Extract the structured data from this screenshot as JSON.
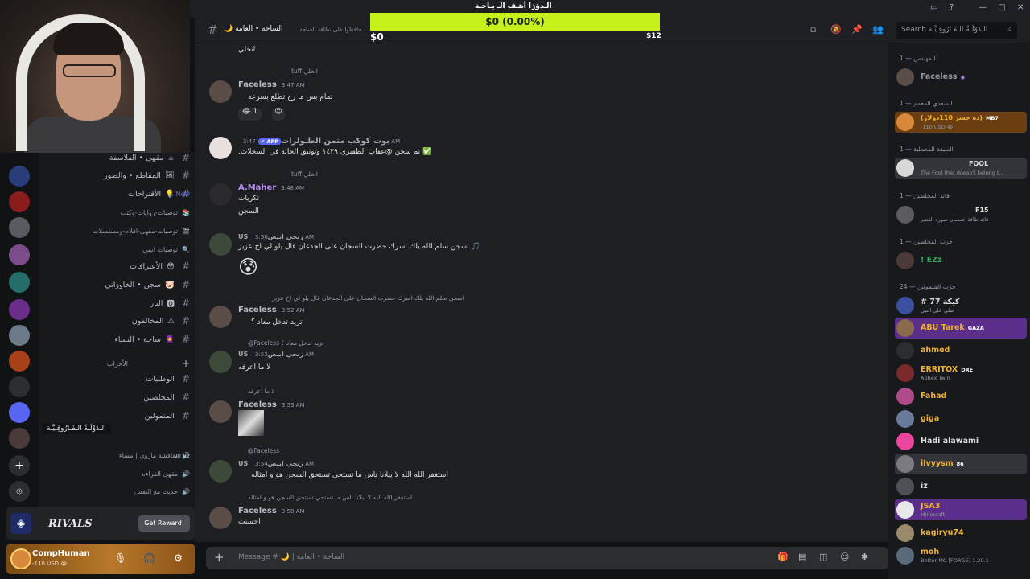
{
  "donation": {
    "title": "الـدۆۯا أهـف الـ يـاحـة",
    "amount_text": "$0 (0.00%)",
    "min": "$0",
    "max": "$12",
    "progress_percent": 0
  },
  "header": {
    "channel": "الساحة • العامة",
    "moon": "🌙",
    "topic": "حافظوا على نظافة الساحة",
    "search_placeholder": "Search الـدَوْلَـةُ الـفَـارُوقِـيَّـة"
  },
  "sidebar": {
    "channels": [
      {
        "label": "مقهى • الفلاسفة",
        "emoji": "☕"
      },
      {
        "label": "المقاطع • والصور",
        "emoji": "🖼"
      },
      {
        "label": "الأقتراحات",
        "emoji": "💡",
        "badge": "1 New"
      },
      {
        "label": "توصيات-روايات-وكتب",
        "emoji": "📚",
        "sub": true
      },
      {
        "label": "توصيات-مقهى-افلام-ومسلسلات",
        "emoji": "🎬",
        "sub": true
      },
      {
        "label": "توصيات انمي",
        "emoji": "🔍",
        "sub": true
      },
      {
        "label": "الأعترافات",
        "emoji": "😳"
      },
      {
        "label": "سجن • الخاوزاتي",
        "emoji": "🐷"
      },
      {
        "label": "البار",
        "emoji": "🅾"
      },
      {
        "label": "المخالفون",
        "emoji": "⚠"
      },
      {
        "label": "ساحة • النساء",
        "emoji": "🧕"
      }
    ],
    "category": "الأحزاب",
    "voice": [
      {
        "label": "الوطنيات"
      },
      {
        "label": "المخلصين"
      },
      {
        "label": "المتمولين"
      }
    ],
    "server_tooltip": "الـدَوْلَـةُ الـفَـارُوقِـيَّـة",
    "voice_sub": [
      {
        "label": "مناقشة ماروي | مساء"
      },
      {
        "label": "مقهى القراءه"
      },
      {
        "label": "حديث مع النفس"
      }
    ],
    "voice_time": "00 02"
  },
  "promo": {
    "brand": "RIVALS",
    "button": "Get Reward!"
  },
  "user": {
    "name": "CompHuman",
    "status": "-110 USD 😭"
  },
  "messages": [
    {
      "type": "cont",
      "text": "انخلي"
    },
    {
      "type": "reply",
      "reply": "tuff انخلي"
    },
    {
      "type": "msg",
      "author": "Faceless",
      "author_color": "#b5bac1",
      "time": "3:47 AM",
      "text": "تمام بس ما رح تطلع بسرعه",
      "reaction": "😂 1"
    },
    {
      "type": "msg",
      "author": "بوت كوكب متمن الطـولرات",
      "author_color": "#a3a6aa",
      "tag": "✔ APP",
      "time": "3:47 AM",
      "text": "✅ تم سجن @عقاب الظفيري ١٤٢٩ وتوثيق الحالة في السجلات."
    },
    {
      "type": "reply",
      "reply": "tuff انخلي"
    },
    {
      "type": "msg",
      "author": "A.Maher",
      "author_color": "#b48cf2",
      "time": "3:48 AM",
      "text": "تكريات",
      "text2": "السجن"
    },
    {
      "type": "msg",
      "author": "US زنجي ابيض",
      "author_color": "#a3a6aa",
      "time": "3:50 AM",
      "text": "🎵 اسجن سلم الله يلك اسرك  حضرت السجان على الجدعان قال يلو لي اخ عزيز",
      "emoji": "😰"
    },
    {
      "type": "reply",
      "reply": "اسجن سلم الله يلك اسرك  حضرت السجان على الجدعان قال يلو لي اخ عزيز"
    },
    {
      "type": "msg",
      "author": "Faceless",
      "author_color": "#b5bac1",
      "time": "3:52 AM",
      "text": "تريد تدخل معاد ؟"
    },
    {
      "type": "reply",
      "reply": "@Faceless تريد تدخل معاد ؟"
    },
    {
      "type": "msg",
      "author": "US زنجي ابيض",
      "author_color": "#a3a6aa",
      "time": "3:52 AM",
      "text": "لا ما اعرفه"
    },
    {
      "type": "reply",
      "reply": "لا ما اعرفه"
    },
    {
      "type": "msg",
      "author": "Faceless",
      "author_color": "#b5bac1",
      "time": "3:53 AM",
      "text": "",
      "image": true
    },
    {
      "type": "reply",
      "reply": "@Faceless"
    },
    {
      "type": "msg",
      "author": "US زنجي ابيض",
      "author_color": "#a3a6aa",
      "time": "3:54 AM",
      "text": "استغفر الله الله لا يبلانا ناس ما تستحي تستحق السجن هو و امثاله"
    },
    {
      "type": "reply",
      "reply": "استغفر الله الله لا يبلانا ناس ما تستحي تستحق السجن هو و امثاله"
    },
    {
      "type": "msg",
      "author": "Faceless",
      "author_color": "#b5bac1",
      "time": "3:58 AM",
      "text": "احسنت"
    }
  ],
  "composer": {
    "placeholder": "Message # 🌙 | الساحة • العامة"
  },
  "members": {
    "groups": [
      {
        "name": "المهندس — 1",
        "items": [
          {
            "name": "Faceless",
            "color": "#949ba4",
            "badge": "◉"
          }
        ]
      },
      {
        "name": "السعدي المعمم — 1",
        "items": [
          {
            "name": "(ده خسر 110دولار)",
            "color": "#f0b232",
            "sub": "-110 USD 😭",
            "badge": "MB7",
            "hl": "#6b3e12"
          }
        ]
      },
      {
        "name": "الطبقة المخملية — 1",
        "items": [
          {
            "name": "FOOL",
            "color": "#dbdee1",
            "sub": "The Fool that doesn't belong t...",
            "hl": "#3a3b40"
          }
        ]
      },
      {
        "name": "قائد المخلصين — 1",
        "items": [
          {
            "name": "F15",
            "color": "#dbdee1",
            "sub": "قائد طاقة خمسان صوره القصر"
          }
        ]
      },
      {
        "name": "حزب المخلصين — 1",
        "items": [
          {
            "name": "! EZz",
            "color": "#3ba55c"
          }
        ]
      },
      {
        "name": "حزب المتمولين — 24",
        "items": [
          {
            "name": "# 77 كيكة",
            "color": "#dbdee1",
            "sub": "صلي على النبي"
          },
          {
            "name": "ABU Tarek",
            "color": "#f0b232",
            "badge": "GAZA",
            "hl": "#5a2e8a"
          },
          {
            "name": "ahmed",
            "color": "#f0b232"
          },
          {
            "name": "ERRITOX",
            "color": "#f0b232",
            "badge": "DRE",
            "sub": "Aphex Twin"
          },
          {
            "name": "Fahad",
            "color": "#f0b232"
          },
          {
            "name": "giga",
            "color": "#f0b232"
          },
          {
            "name": "Hadi alawami",
            "color": "#dbdee1"
          },
          {
            "name": "ilvyysm",
            "color": "#f0b232",
            "badge": "86",
            "hl": "#33343a"
          },
          {
            "name": "iz",
            "color": "#dbdee1"
          },
          {
            "name": "JSA3",
            "color": "#f0b232",
            "sub": "Minecraft",
            "hl": "#5a2e8a"
          },
          {
            "name": "kagiryu74",
            "color": "#f0b232"
          },
          {
            "name": "moh",
            "color": "#f0b232",
            "sub": "Better MC [FORGE] 1.20.1"
          }
        ]
      }
    ]
  }
}
